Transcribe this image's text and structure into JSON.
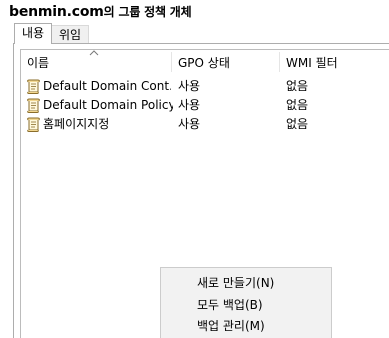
{
  "title": {
    "domain": "benmin.com",
    "suffix": "의 그룹 정책 개체"
  },
  "tabs": [
    {
      "label": "내용",
      "active": true
    },
    {
      "label": "위임",
      "active": false
    }
  ],
  "columns": {
    "name": "이름",
    "gpo_status": "GPO 상태",
    "wmi_filter": "WMI 필터"
  },
  "rows": [
    {
      "name": "Default Domain Cont...",
      "gpo_status": "사용",
      "wmi_filter": "없음"
    },
    {
      "name": "Default Domain Policy",
      "gpo_status": "사용",
      "wmi_filter": "없음"
    },
    {
      "name": "홈페이지지정",
      "gpo_status": "사용",
      "wmi_filter": "없음"
    }
  ],
  "context_menu": {
    "items": [
      {
        "label": "새로 만들기(N)"
      },
      {
        "label": "모두 백업(B)"
      },
      {
        "label": "백업 관리(M)"
      }
    ]
  },
  "colors": {
    "menu_background": "#f2f2f2",
    "border": "#adadad",
    "inactive_tab": "#f0f0f0"
  }
}
